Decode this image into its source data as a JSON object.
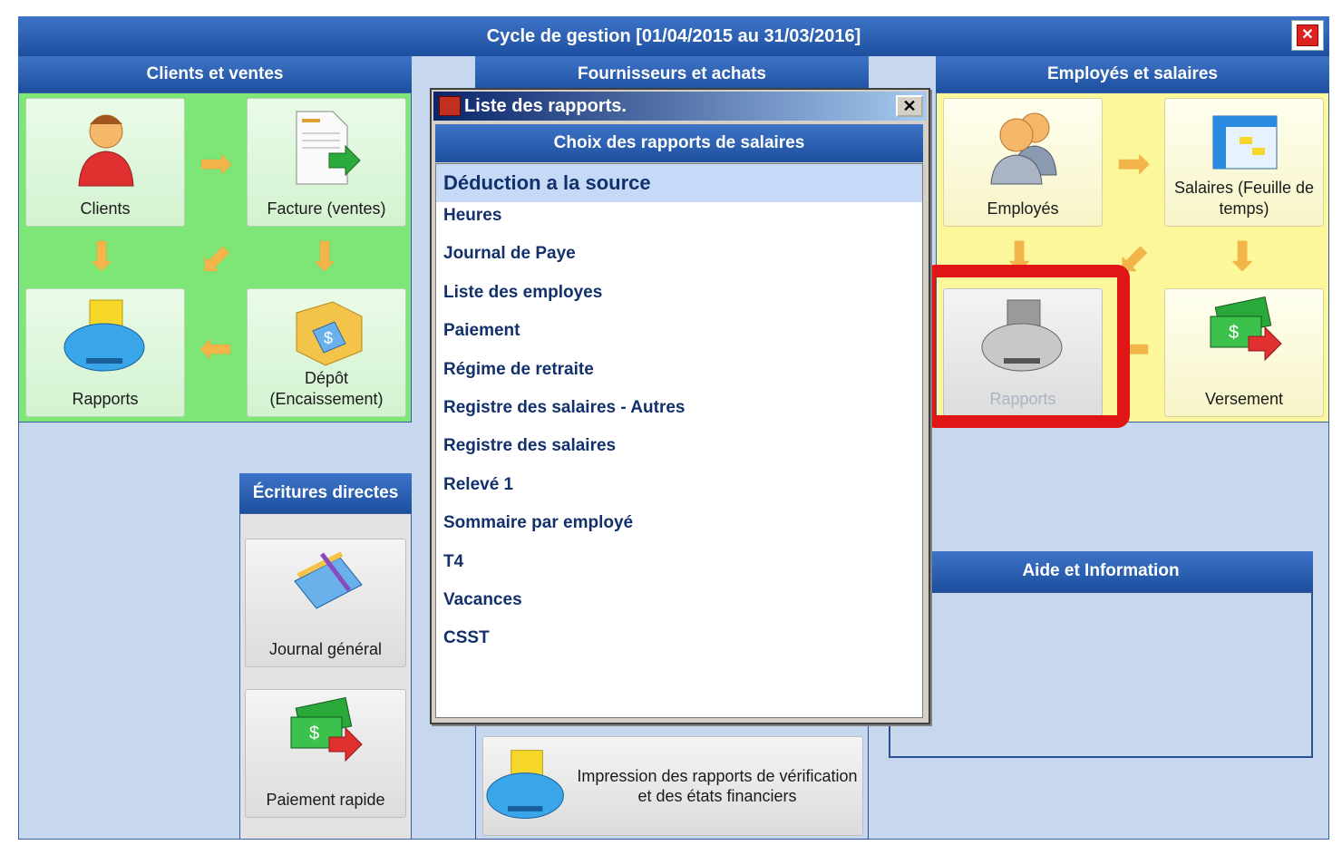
{
  "window": {
    "title": "Cycle de gestion [01/04/2015 au 31/03/2016]",
    "close_icon": "close-icon"
  },
  "clients": {
    "header": "Clients et ventes",
    "tiles": {
      "clients": "Clients",
      "facture": "Facture (ventes)",
      "rapports": "Rapports",
      "depot": "Dépôt\n(Encaissement)"
    }
  },
  "fournisseurs": {
    "header": "Fournisseurs et achats"
  },
  "employes": {
    "header": "Employés et salaires",
    "tiles": {
      "employes": "Employés",
      "salaires": "Salaires (Feuille de temps)",
      "rapports": "Rapports",
      "versement": "Versement"
    }
  },
  "ecritures": {
    "header": "Écritures directes",
    "tiles": {
      "journal": "Journal général",
      "paiement": "Paiement rapide"
    }
  },
  "impression": {
    "label": "Impression des rapports de vérification et des états financiers"
  },
  "aide": {
    "header": "Aide et Information"
  },
  "dialog": {
    "title": "Liste des rapports.",
    "close": "✕",
    "subtitle": "Choix des rapports de salaires",
    "items": [
      "Déduction a la source",
      "Heures",
      "Journal de Paye",
      "Liste des employes",
      "Paiement",
      "Régime de retraite",
      "Registre des salaires - Autres",
      "Registre des salaires",
      "Relevé 1",
      "Sommaire par employé",
      "T4",
      "Vacances",
      "CSST"
    ],
    "selected_index": 0
  },
  "colors": {
    "accent_blue": "#1e4f9f",
    "green_panel": "#7ee577",
    "yellow_panel": "#fbf79a",
    "annotation_red": "#e01515",
    "list_text": "#12306b"
  }
}
